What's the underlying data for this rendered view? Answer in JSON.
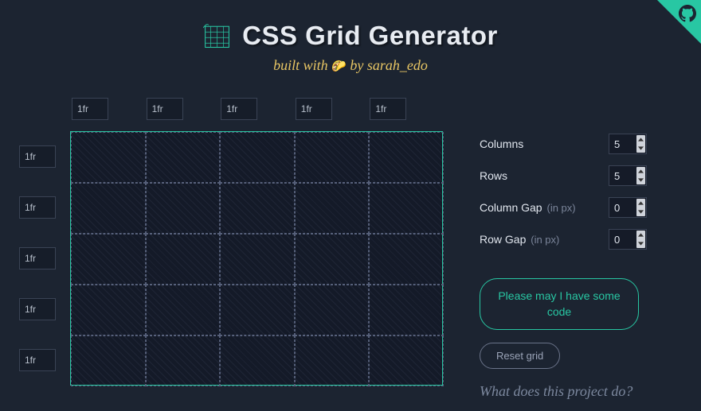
{
  "header": {
    "title": "CSS Grid Generator",
    "subtitle_pre": "built with",
    "subtitle_emoji": "🌮",
    "subtitle_post": "by sarah_edo"
  },
  "columns": [
    "1fr",
    "1fr",
    "1fr",
    "1fr",
    "1fr"
  ],
  "rows": [
    "1fr",
    "1fr",
    "1fr",
    "1fr",
    "1fr"
  ],
  "controls": {
    "columns": {
      "label": "Columns",
      "value": "5"
    },
    "rows": {
      "label": "Rows",
      "value": "5"
    },
    "column_gap": {
      "label": "Column Gap",
      "hint": "(in px)",
      "value": "0"
    },
    "row_gap": {
      "label": "Row Gap",
      "hint": "(in px)",
      "value": "0"
    }
  },
  "buttons": {
    "generate": "Please may I have some code",
    "reset": "Reset grid"
  },
  "link": {
    "what": "What does this project do?"
  },
  "icons": {
    "github": "github-icon",
    "grid_logo": "grid-logo-icon"
  },
  "colors": {
    "accent": "#28c7a3",
    "bg": "#1c2431",
    "highlight": "#e8c664"
  }
}
